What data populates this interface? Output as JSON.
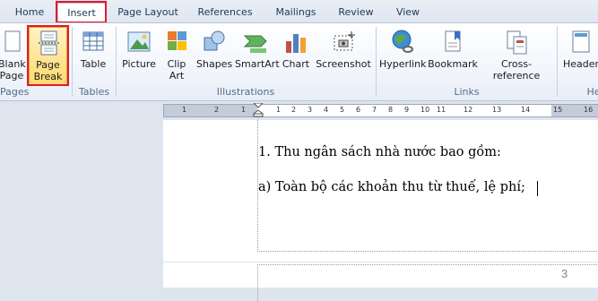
{
  "tabs": [
    "Home",
    "Insert",
    "Page Layout",
    "References",
    "Mailings",
    "Review",
    "View"
  ],
  "active_tab": "Insert",
  "ribbon": {
    "blank_page": "Blank\nPage",
    "page_break": "Page\nBreak",
    "table": "Table",
    "picture": "Picture",
    "clip_art": "Clip\nArt",
    "shapes": "Shapes",
    "smartart": "SmartArt",
    "chart": "Chart",
    "screenshot": "Screenshot",
    "hyperlink": "Hyperlink",
    "bookmark": "Bookmark",
    "cross_reference": "Cross-reference",
    "header": "Header",
    "groups": {
      "pages": "Pages",
      "tables": "Tables",
      "illustrations": "Illustrations",
      "links": "Links",
      "header_footer": "He"
    }
  },
  "ruler": {
    "numbers": [
      "1",
      "2",
      "1",
      "1",
      "2",
      "3",
      "4",
      "5",
      "6",
      "7",
      "8",
      "9",
      "10",
      "11",
      "12",
      "13",
      "14",
      "15",
      "16"
    ]
  },
  "document": {
    "line1": "1. Thu ngân sách nhà nước bao gồm:",
    "line2": "a) Toàn bộ các khoản thu từ thuế, lệ phí;",
    "page_number": "3"
  },
  "colors": {
    "accent_red": "#e3182d",
    "selected": "#ffd970"
  }
}
